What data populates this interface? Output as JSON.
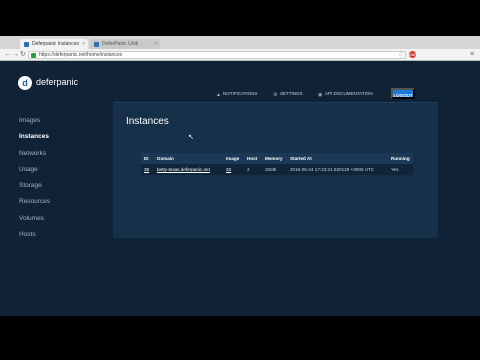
{
  "browser": {
    "tabs": [
      {
        "title": "Deferpanic Instances"
      },
      {
        "title": "DeferPanic Unik"
      }
    ],
    "url": "https://deferpanic.net/home/instances",
    "extension_badge": "ABP"
  },
  "app": {
    "logo_text": "deferpanic",
    "logo_mark": "d",
    "sidebar": {
      "items": [
        {
          "label": "Images",
          "active": false
        },
        {
          "label": "Instances",
          "active": true
        },
        {
          "label": "Networks",
          "active": false
        },
        {
          "label": "Usage",
          "active": false
        },
        {
          "label": "Storage",
          "active": false
        },
        {
          "label": "Resources",
          "active": false
        },
        {
          "label": "Volumes",
          "active": false
        },
        {
          "label": "Hosts",
          "active": false
        }
      ]
    },
    "topnav": {
      "notifications": "NOTIFICATIONS",
      "settings": "SETTINGS",
      "api_docs": "API DOCUMENTATION",
      "logout": "LOGOUT"
    },
    "page_title": "Instances",
    "table": {
      "columns": [
        "ID",
        "Domain",
        "Image",
        "Host",
        "Memory",
        "Started At",
        "Running"
      ],
      "rows": [
        {
          "id": "39",
          "domain": "betty-texas.deferpanic.net",
          "image": "33",
          "host": "2",
          "memory": "32Mb",
          "started_at": "2016-05-24 17:23:21.520128 +0000 UTC",
          "running": "Yes"
        }
      ]
    }
  },
  "colors": {
    "background": "#0f2236",
    "panel": "#163049",
    "accent": "#1d78d6"
  }
}
